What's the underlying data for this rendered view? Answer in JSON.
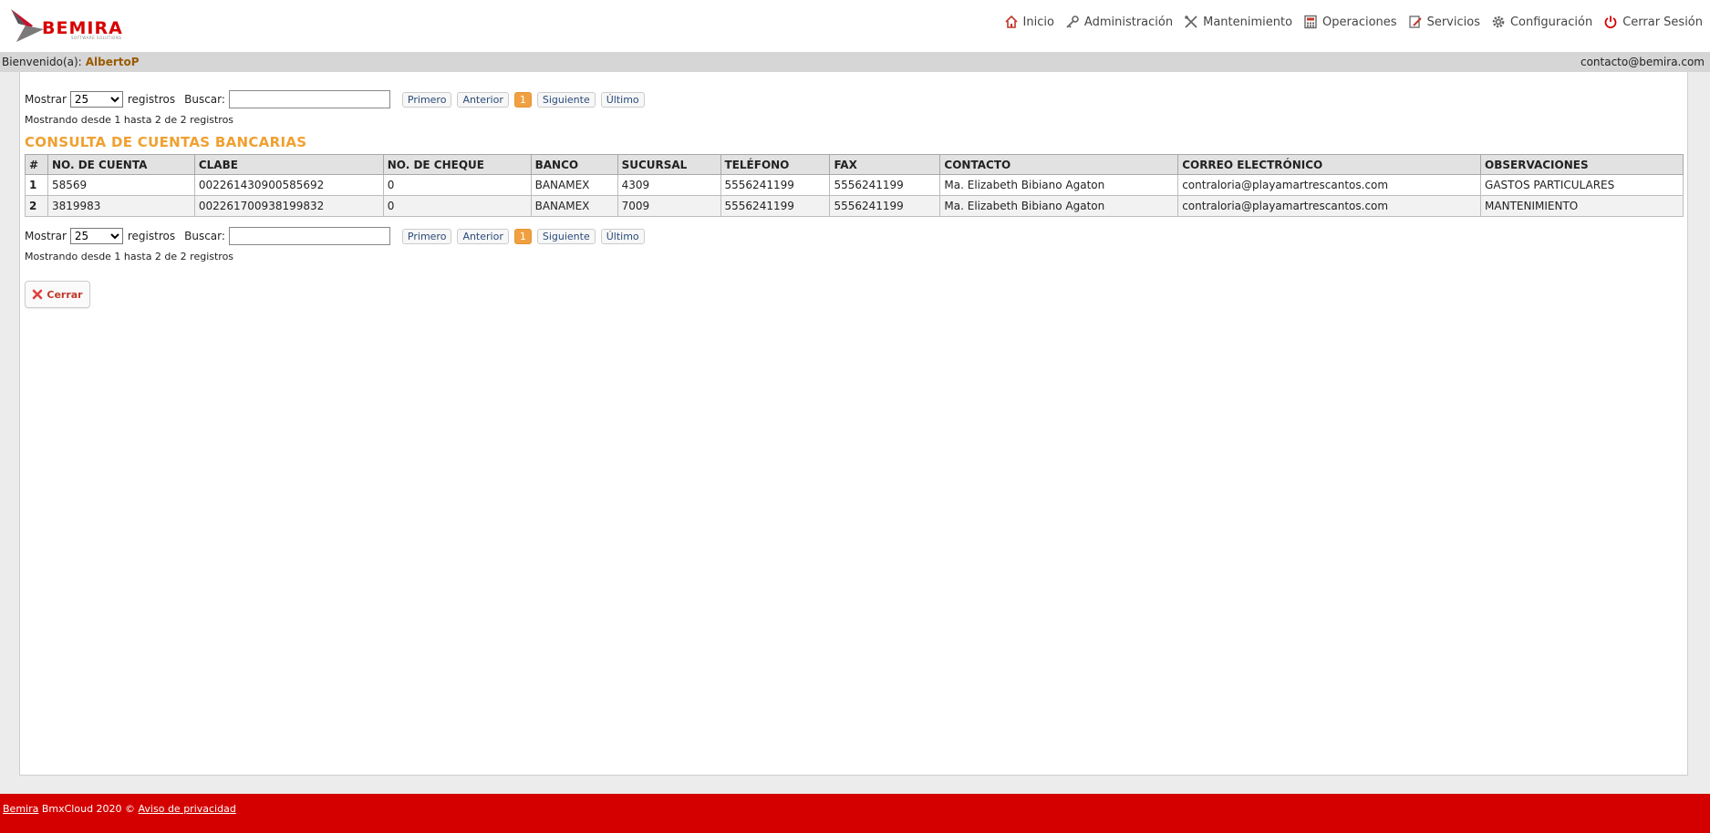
{
  "header": {
    "logo_text": "BEMIRA",
    "logo_subtext": "SOFTWARE SOLUTIONS",
    "nav": [
      {
        "label": "Inicio",
        "icon": "home-icon"
      },
      {
        "label": "Administración",
        "icon": "key-icon"
      },
      {
        "label": "Mantenimiento",
        "icon": "tools-icon"
      },
      {
        "label": "Operaciones",
        "icon": "calculator-icon"
      },
      {
        "label": "Servicios",
        "icon": "edit-icon"
      },
      {
        "label": "Configuración",
        "icon": "gear-icon"
      },
      {
        "label": "Cerrar Sesión",
        "icon": "power-icon"
      }
    ]
  },
  "welcome": {
    "label": "Bienvenido(a):",
    "user": "AlbertoP",
    "email": "contacto@bemira.com"
  },
  "controls": {
    "show_label": "Mostrar",
    "show_value": "25",
    "records_label": "registros",
    "search_label": "Buscar:",
    "search_value": "",
    "pager": {
      "first": "Primero",
      "prev": "Anterior",
      "page": "1",
      "next": "Siguiente",
      "last": "Último"
    },
    "info": "Mostrando desde 1 hasta 2 de 2 registros"
  },
  "title": "CONSULTA DE CUENTAS BANCARIAS",
  "table": {
    "columns": [
      "#",
      "NO. DE CUENTA",
      "CLABE",
      "NO. DE CHEQUE",
      "BANCO",
      "SUCURSAL",
      "TELÉFONO",
      "FAX",
      "CONTACTO",
      "CORREO ELECTRÓNICO",
      "OBSERVACIONES"
    ],
    "rows": [
      [
        "1",
        "58569",
        "002261430900585692",
        "0",
        "BANAMEX",
        "4309",
        "5556241199",
        "5556241199",
        "Ma. Elizabeth Bibiano Agaton",
        "contraloria@playamartrescantos.com",
        "GASTOS PARTICULARES"
      ],
      [
        "2",
        "3819983",
        "002261700938199832",
        "0",
        "BANAMEX",
        "7009",
        "5556241199",
        "5556241199",
        "Ma. Elizabeth Bibiano Agaton",
        "contraloria@playamartrescantos.com",
        "MANTENIMIENTO"
      ]
    ]
  },
  "close_button": "Cerrar",
  "footer": {
    "brand_link": "Bemira",
    "text": " BmxCloud 2020 © ",
    "privacy_link": "Aviso de privacidad"
  },
  "colors": {
    "brand_red": "#d40000",
    "title_orange": "#f0a030",
    "user_brown": "#9a5b00"
  }
}
